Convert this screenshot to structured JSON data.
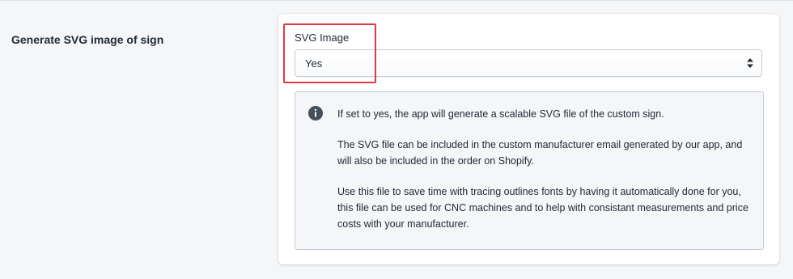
{
  "section": {
    "title": "Generate SVG image of sign"
  },
  "field": {
    "label": "SVG Image",
    "selected_value": "Yes"
  },
  "info": {
    "icon": "info-circle-icon",
    "paragraphs": [
      "If set to yes, the app will generate a scalable SVG file of the custom sign.",
      "The SVG file can be included in the custom manufacturer email generated by our app, and will also be included in the order on Shopify.",
      "Use this file to save time with tracing outlines fonts by having it automatically done for you, this file can be used for CNC machines and to help with consistant measurements and price costs with your manufacturer."
    ]
  },
  "colors": {
    "highlight": "#e0393e",
    "info_icon": "#454f5b"
  }
}
